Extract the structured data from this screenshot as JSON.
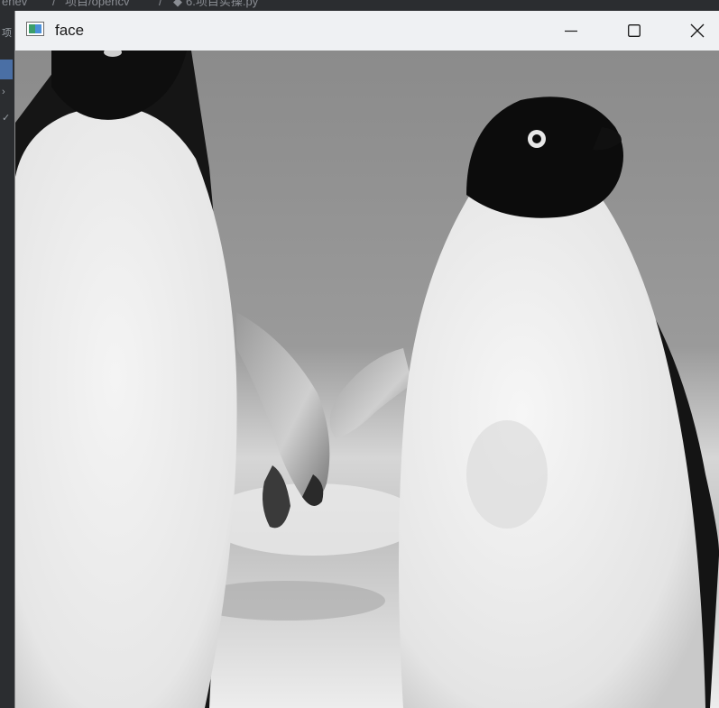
{
  "ide": {
    "breadcrumb_1": "enev",
    "breadcrumb_2": "项目/opencv",
    "breadcrumb_3": "6.项目实操.py",
    "left_glyph": "项"
  },
  "window": {
    "title": "face",
    "controls": [
      "minimize",
      "maximize",
      "close"
    ]
  },
  "image": {
    "subject": "two penguins (grayscale)",
    "colors": {
      "sky": "#8f8f8f",
      "black": "#101010",
      "white": "#f2f2f2"
    }
  }
}
